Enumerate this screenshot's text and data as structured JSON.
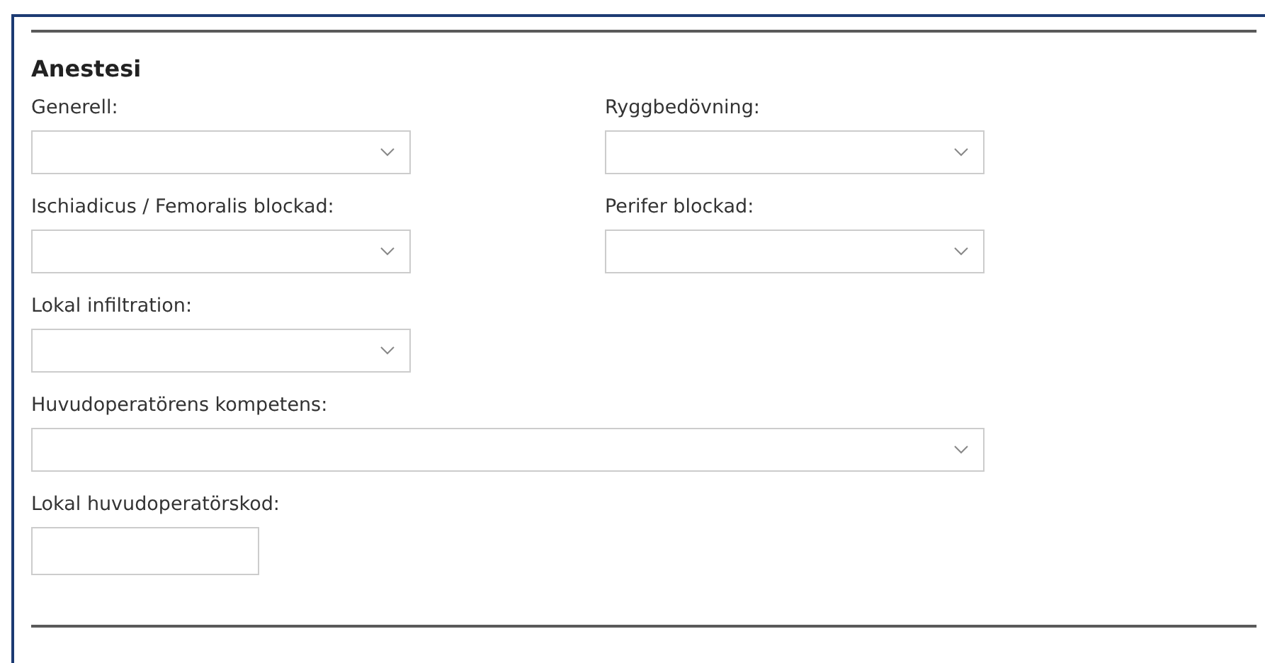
{
  "section": {
    "title": "Anestesi"
  },
  "rows": [
    [
      {
        "label": "Generell:",
        "kind": "select"
      },
      {
        "label": "Ryggbedövning:",
        "kind": "select"
      }
    ],
    [
      {
        "label": "Ischiadicus / Femoralis blockad:",
        "kind": "select"
      },
      {
        "label": "Perifer blockad:",
        "kind": "select"
      }
    ],
    [
      {
        "label": "Lokal infiltration:",
        "kind": "select"
      }
    ],
    [
      {
        "label": "Huvudoperatörens kompetens:",
        "kind": "wide-select"
      }
    ],
    [
      {
        "label": "Lokal huvudoperatörskod:",
        "kind": "text"
      }
    ]
  ]
}
